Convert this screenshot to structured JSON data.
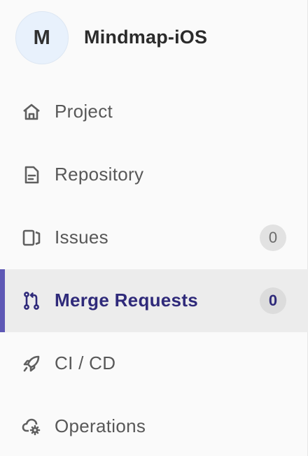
{
  "project": {
    "avatar_letter": "M",
    "name": "Mindmap-iOS"
  },
  "nav": {
    "items": [
      {
        "label": "Project",
        "icon": "home-icon"
      },
      {
        "label": "Repository",
        "icon": "document-icon"
      },
      {
        "label": "Issues",
        "icon": "issues-icon",
        "count": "0"
      },
      {
        "label": "Merge Requests",
        "icon": "merge-request-icon",
        "count": "0",
        "active": true
      },
      {
        "label": "CI / CD",
        "icon": "rocket-icon"
      },
      {
        "label": "Operations",
        "icon": "cloud-gear-icon"
      }
    ]
  },
  "colors": {
    "active_indicator": "#5e58b5",
    "active_text": "#2f2a7a",
    "text": "#585858",
    "avatar_bg": "#e8f1fc"
  }
}
